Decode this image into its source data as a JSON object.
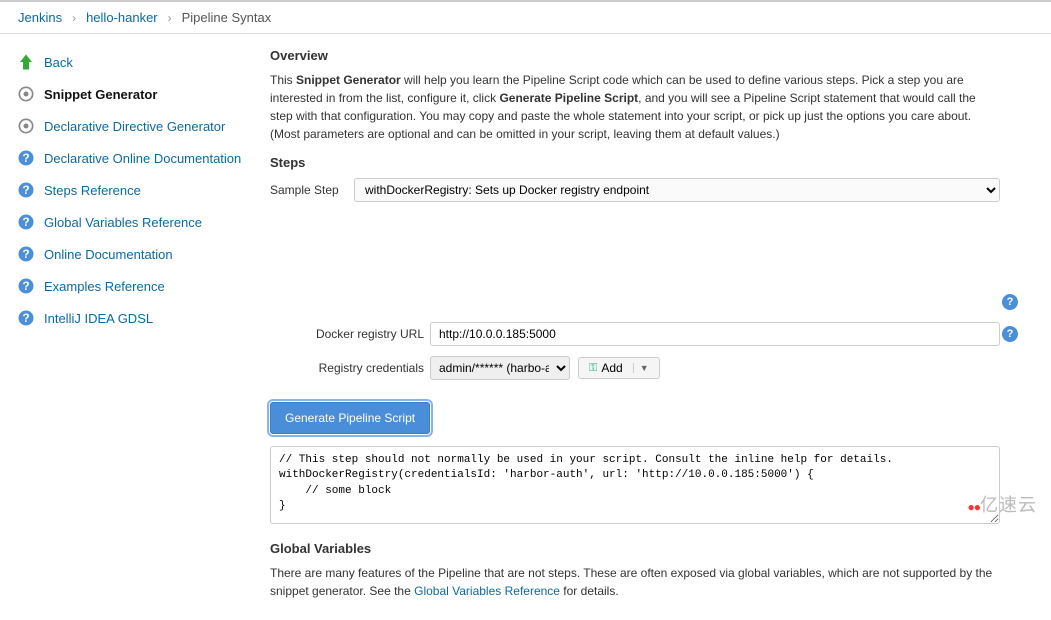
{
  "breadcrumb": {
    "items": [
      "Jenkins",
      "hello-hanker",
      "Pipeline Syntax"
    ]
  },
  "sidebar": {
    "items": [
      {
        "label": "Back",
        "icon": "back"
      },
      {
        "label": "Snippet Generator",
        "icon": "gear",
        "active": true
      },
      {
        "label": "Declarative Directive Generator",
        "icon": "gear"
      },
      {
        "label": "Declarative Online Documentation",
        "icon": "help"
      },
      {
        "label": "Steps Reference",
        "icon": "help"
      },
      {
        "label": "Global Variables Reference",
        "icon": "help"
      },
      {
        "label": "Online Documentation",
        "icon": "help"
      },
      {
        "label": "Examples Reference",
        "icon": "help"
      },
      {
        "label": "IntelliJ IDEA GDSL",
        "icon": "help"
      }
    ]
  },
  "main": {
    "overview_title": "Overview",
    "overview_pre": "This ",
    "overview_bold1": "Snippet Generator",
    "overview_mid1": " will help you learn the Pipeline Script code which can be used to define various steps. Pick a step you are interested in from the list, configure it, click ",
    "overview_bold2": "Generate Pipeline Script",
    "overview_post": ", and you will see a Pipeline Script statement that would call the step with that configuration. You may copy and paste the whole statement into your script, or pick up just the options you care about. (Most parameters are optional and can be omitted in your script, leaving them at default values.)",
    "steps_title": "Steps",
    "sample_step_label": "Sample Step",
    "sample_step_value": "withDockerRegistry: Sets up Docker registry endpoint",
    "docker_url_label": "Docker registry URL",
    "docker_url_value": "http://10.0.0.185:5000",
    "registry_cred_label": "Registry credentials",
    "registry_cred_value": "admin/****** (harbo-auth)",
    "add_button": "Add",
    "generate_button": "Generate Pipeline Script",
    "code_output": "// This step should not normally be used in your script. Consult the inline help for details.\nwithDockerRegistry(credentialsId: 'harbor-auth', url: 'http://10.0.0.185:5000') {\n    // some block\n}",
    "gv_title": "Global Variables",
    "gv_text_pre": "There are many features of the Pipeline that are not steps. These are often exposed via global variables, which are not supported by the snippet generator. See the ",
    "gv_link": "Global Variables Reference",
    "gv_text_post": " for details."
  },
  "watermark": "亿速云"
}
